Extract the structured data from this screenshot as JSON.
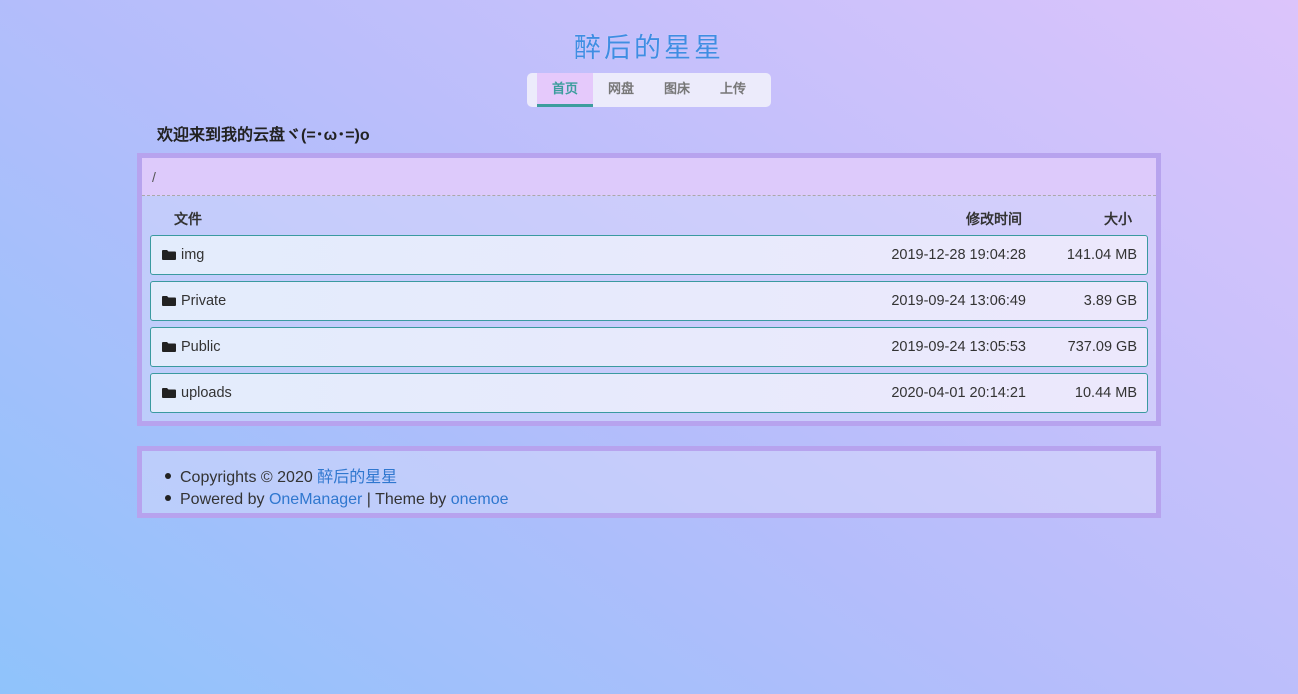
{
  "site": {
    "title": "醉后的星星"
  },
  "nav": {
    "items": [
      "首页",
      "网盘",
      "图床",
      "上传"
    ],
    "active": 0
  },
  "welcome": "欢迎来到我的云盘ヾ(=･ω･=)o",
  "breadcrumb": "/",
  "table": {
    "headers": {
      "file": "文件",
      "time": "修改时间",
      "size": "大小"
    },
    "rows": [
      {
        "name": "img",
        "time": "2019-12-28 19:04:28",
        "size": "141.04 MB",
        "icon": "folder-icon"
      },
      {
        "name": "Private",
        "time": "2019-09-24 13:06:49",
        "size": "3.89 GB",
        "icon": "folder-icon"
      },
      {
        "name": "Public",
        "time": "2019-09-24 13:05:53",
        "size": "737.09 GB",
        "icon": "folder-icon"
      },
      {
        "name": "uploads",
        "time": "2020-04-01 20:14:21",
        "size": "10.44 MB",
        "icon": "folder-icon"
      }
    ]
  },
  "footer": {
    "copyright_prefix": "Copyrights © 2020",
    "copyright_link": "醉后的星星",
    "powered_prefix": "Powered by",
    "powered_link": "OneManager",
    "theme_sep": "| Theme by",
    "theme_link": "onemoe"
  },
  "colors": {
    "accent": "#3d9d9d",
    "link": "#2f77cf",
    "title": "#3f8de3",
    "border": "#b7a3ee"
  }
}
